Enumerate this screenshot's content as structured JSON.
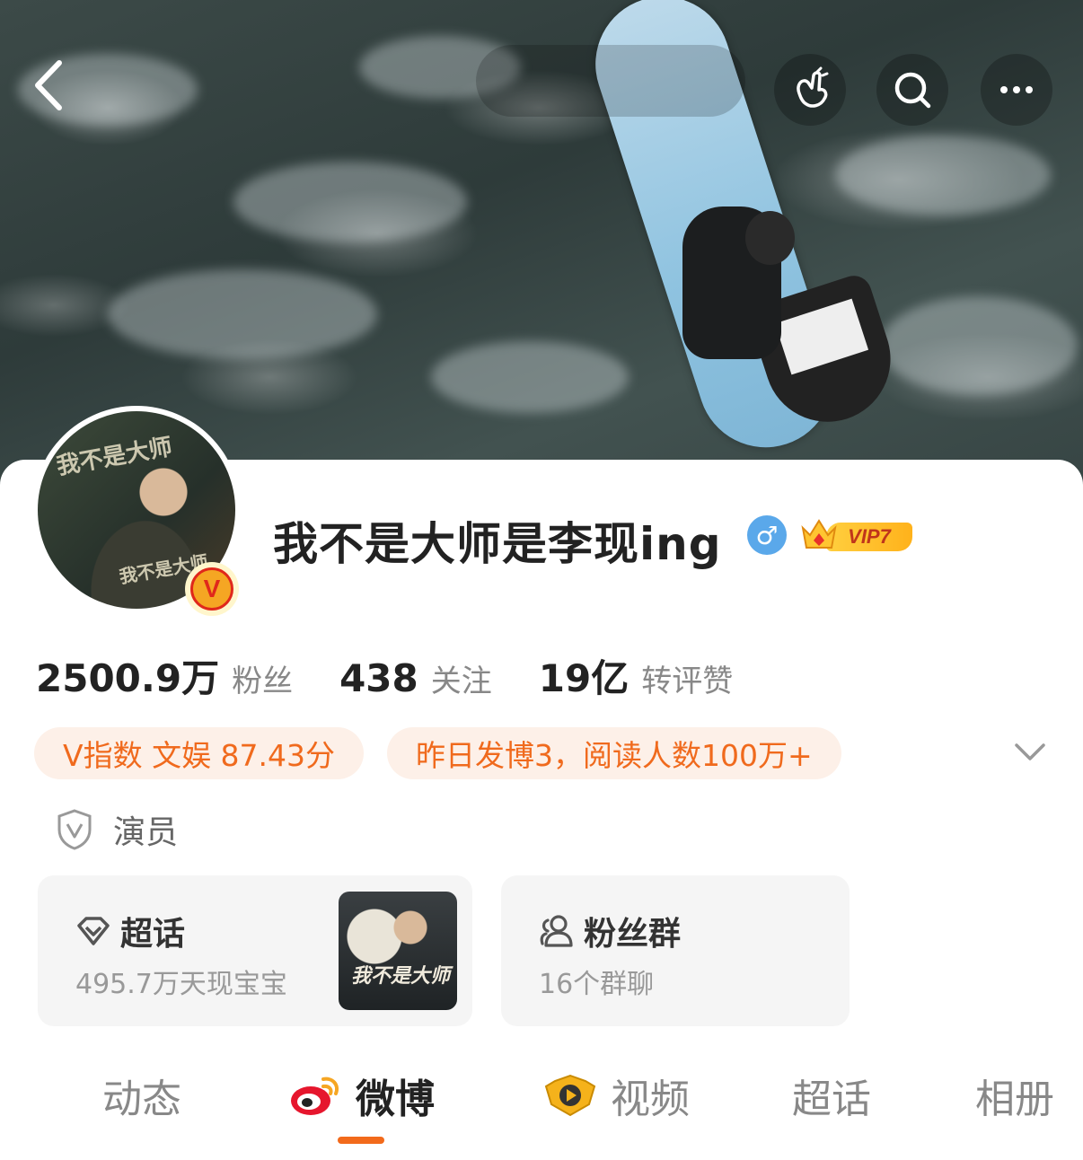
{
  "profile": {
    "name": "我不是大师是李现ing",
    "gender_symbol": "♂",
    "vip_label": "VIP7",
    "verified_badge": "V",
    "avatar_text": [
      "我不是大师",
      "我不是大师"
    ]
  },
  "stats": [
    {
      "value": "2500.9万",
      "label": "粉丝"
    },
    {
      "value": "438",
      "label": "关注"
    },
    {
      "value": "19亿",
      "label": "转评赞"
    }
  ],
  "tags": [
    "V指数 文娱 87.43分",
    "昨日发博3，阅读人数100万+"
  ],
  "verification": {
    "label": "演员"
  },
  "supertopic": {
    "title": "超话",
    "subtitle": "495.7万天现宝宝",
    "poster_text": "我不是大师"
  },
  "fan_group": {
    "title": "粉丝群",
    "subtitle": "16个群聊"
  },
  "tabs": [
    {
      "label": "动态"
    },
    {
      "label": "微博"
    },
    {
      "label": "视频"
    },
    {
      "label": "超话"
    },
    {
      "label": "相册"
    }
  ],
  "active_tab": "微博",
  "icons": {
    "back": "back-arrow-icon",
    "gesture": "finger-heart-icon",
    "search": "search-icon",
    "more": "more-dots-icon",
    "expand": "chevron-down-icon"
  },
  "colors": {
    "accent": "#f26a1b",
    "tag_text": "#f06a1d",
    "tag_bg": "#fdf0e8",
    "gender": "#5aa8ea"
  }
}
